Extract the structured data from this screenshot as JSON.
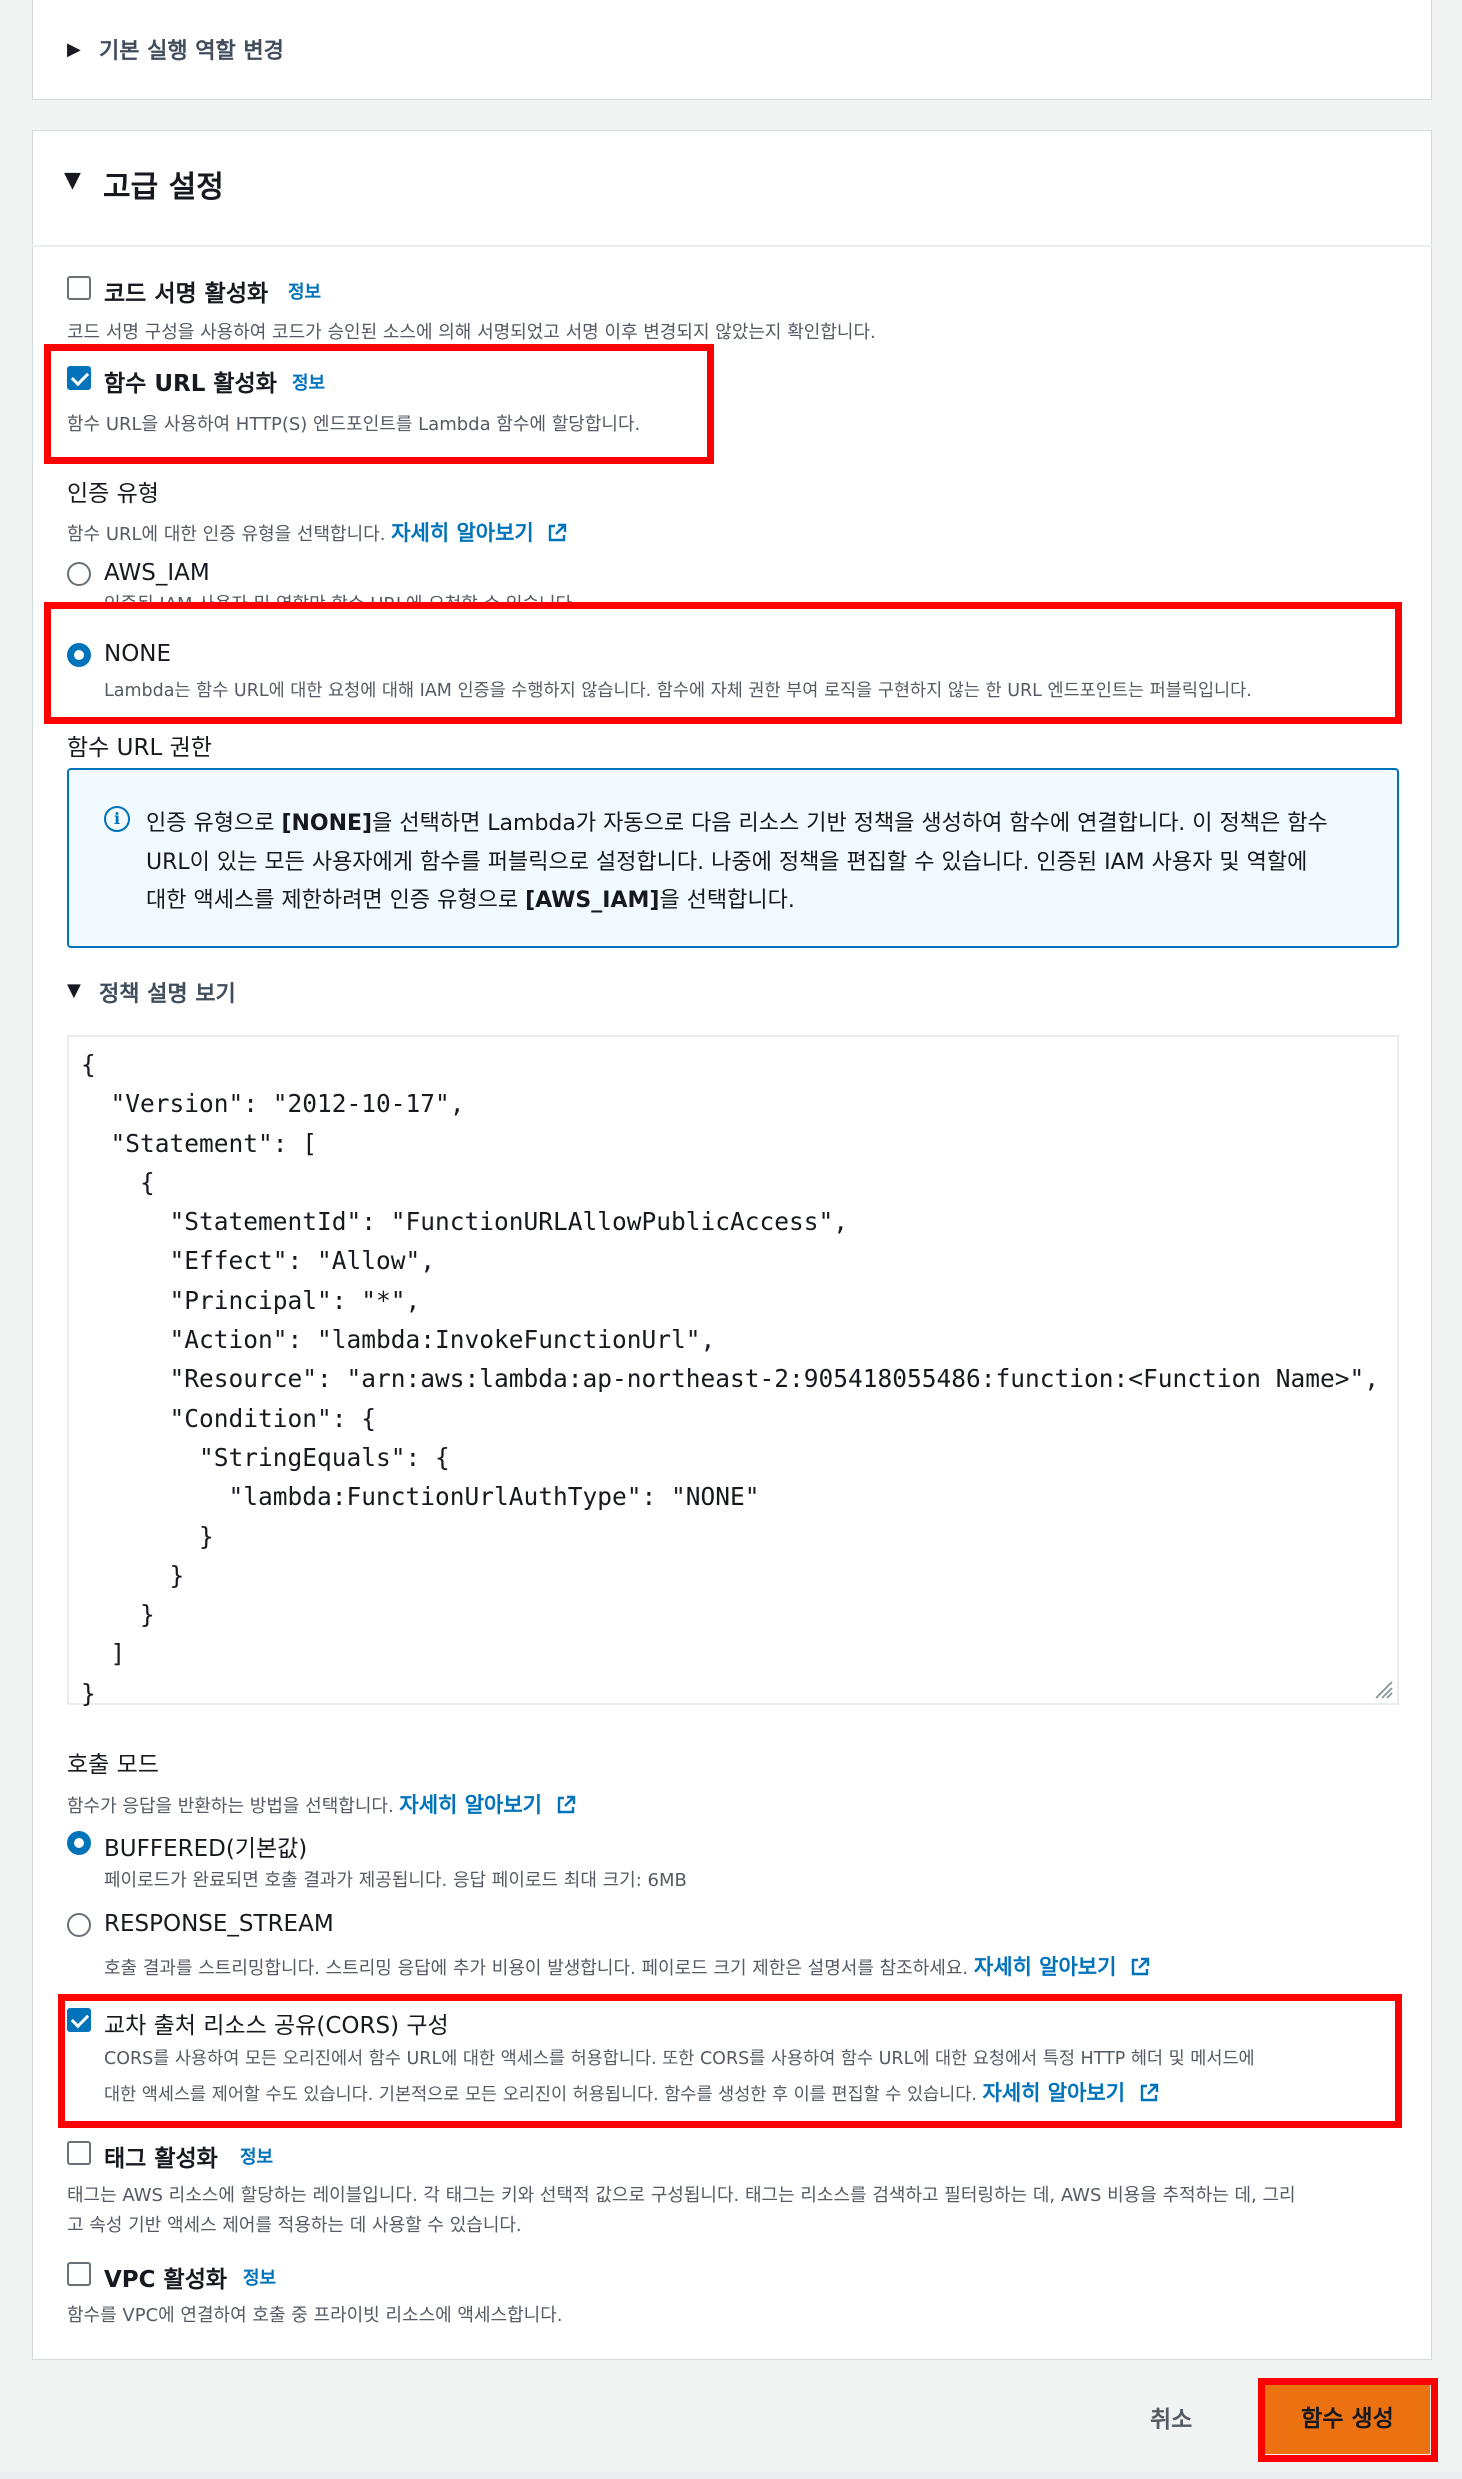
{
  "basic_role": {
    "label": "기본 실행 역할 변경"
  },
  "advanced": {
    "title": "고급 설정",
    "code_signing": {
      "label": "코드 서명 활성화",
      "info": "정보",
      "checked": false,
      "desc": "코드 서명 구성을 사용하여 코드가 승인된 소스에 의해 서명되었고 서명 이후 변경되지 않았는지 확인합니다."
    },
    "function_url": {
      "label": "함수 URL 활성화",
      "info": "정보",
      "checked": true,
      "desc": "함수 URL을 사용하여 HTTP(S) 엔드포인트를 Lambda 함수에 할당합니다."
    },
    "auth_type": {
      "title": "인증 유형",
      "desc": "함수 URL에 대한 인증 유형을 선택합니다.",
      "learn_more": "자세히 알아보기",
      "options": [
        {
          "label": "AWS_IAM",
          "desc": "인증된 IAM 사용자 및 역할만 함수 URL에 요청할 수 있습니다.",
          "selected": false
        },
        {
          "label": "NONE",
          "desc": "Lambda는 함수 URL에 대한 요청에 대해 IAM 인증을 수행하지 않습니다. 함수에 자체 권한 부여 로직을 구현하지 않는 한 URL 엔드포인트는 퍼블릭입니다.",
          "selected": true
        }
      ]
    },
    "url_permissions": {
      "title": "함수 URL 권한",
      "alert_lines": [
        {
          "p1": "인증 유형으로 ",
          "b1": "[NONE]",
          "p2": "을 선택하면 Lambda가 자동으로 다음 리소스 기반 정책을 생성하여 함수에 연결합니다. 이 정책은 함수"
        },
        {
          "p1": "URL이 있는 모든 사용자에게 함수를 퍼블릭으로 설정합니다. 나중에 정책을 편집할 수 있습니다. 인증된 IAM 사용자 및 역할에"
        },
        {
          "p1": "대한 액세스를 제한하려면 인증 유형으로 ",
          "b1": "[AWS_IAM]",
          "p2": "을 선택합니다."
        }
      ],
      "policy_toggle": "정책 설명 보기",
      "policy_json": "{\n  \"Version\": \"2012-10-17\",\n  \"Statement\": [\n    {\n      \"StatementId\": \"FunctionURLAllowPublicAccess\",\n      \"Effect\": \"Allow\",\n      \"Principal\": \"*\",\n      \"Action\": \"lambda:InvokeFunctionUrl\",\n      \"Resource\": \"arn:aws:lambda:ap-northeast-2:905418055486:function:<Function Name>\",\n      \"Condition\": {\n        \"StringEquals\": {\n          \"lambda:FunctionUrlAuthType\": \"NONE\"\n        }\n      }\n    }\n  ]\n}"
    },
    "invoke_mode": {
      "title": "호출 모드",
      "desc": "함수가 응답을 반환하는 방법을 선택합니다.",
      "learn_more": "자세히 알아보기",
      "options": [
        {
          "label": "BUFFERED(기본값)",
          "desc": "페이로드가 완료되면 호출 결과가 제공됩니다. 응답 페이로드 최대 크기: 6MB",
          "selected": true
        },
        {
          "label": "RESPONSE_STREAM",
          "desc": "호출 결과를 스트리밍합니다. 스트리밍 응답에 추가 비용이 발생합니다. 페이로드 크기 제한은 설명서를 참조하세요.",
          "learn_more": "자세히 알아보기",
          "selected": false
        }
      ]
    },
    "cors": {
      "label": "교차 출처 리소스 공유(CORS) 구성",
      "checked": true,
      "desc1": "CORS를 사용하여 모든 오리진에서 함수 URL에 대한 액세스를 허용합니다. 또한 CORS를 사용하여 함수 URL에 대한 요청에서 특정 HTTP 헤더 및 메서드에",
      "desc2": "대한 액세스를 제어할 수도 있습니다. 기본적으로 모든 오리진이 허용됩니다. 함수를 생성한 후 이를 편집할 수 있습니다.",
      "learn_more": "자세히 알아보기"
    },
    "tags": {
      "label": "태그 활성화",
      "info": "정보",
      "checked": false,
      "desc1": "태그는 AWS 리소스에 할당하는 레이블입니다. 각 태그는 키와 선택적 값으로 구성됩니다. 태그는 리소스를 검색하고 필터링하는 데, AWS 비용을 추적하는 데, 그리",
      "desc2": "고 속성 기반 액세스 제어를 적용하는 데 사용할 수 있습니다."
    },
    "vpc": {
      "label": "VPC 활성화",
      "info": "정보",
      "checked": false,
      "desc": "함수를 VPC에 연결하여 호출 중 프라이빗 리소스에 액세스합니다."
    }
  },
  "footer": {
    "cancel": "취소",
    "create": "함수 생성"
  },
  "colors": {
    "accent": "#0073bb",
    "primary_button": "#ec7211",
    "highlight": "#ff0000"
  }
}
